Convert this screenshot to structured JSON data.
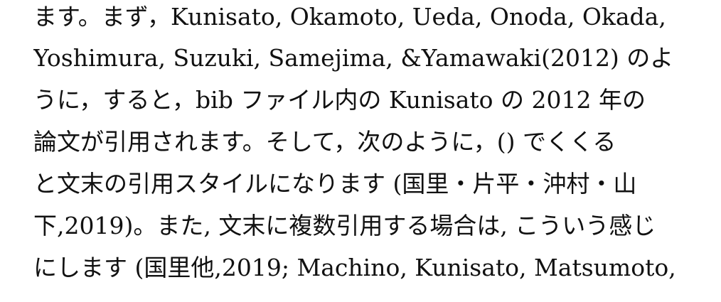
{
  "document": {
    "lines": [
      "ます。まず，Kunisato, Okamoto, Ueda, Onoda, Okada,",
      "Yoshimura, Suzuki, Samejima, &Yamawaki(2012) のよ",
      "うに，すると，bib ファイル内の Kunisato の 2012 年の",
      "論文が引用されます。そして，次のように，() でくくる",
      "と文末の引用スタイルになります (国里・片平・沖村・山",
      "下,2019)。また, 文末に複数引用する場合は, こういう感じ",
      "にします (国里他,2019; Machino, Kunisato, Matsumoto,"
    ]
  }
}
